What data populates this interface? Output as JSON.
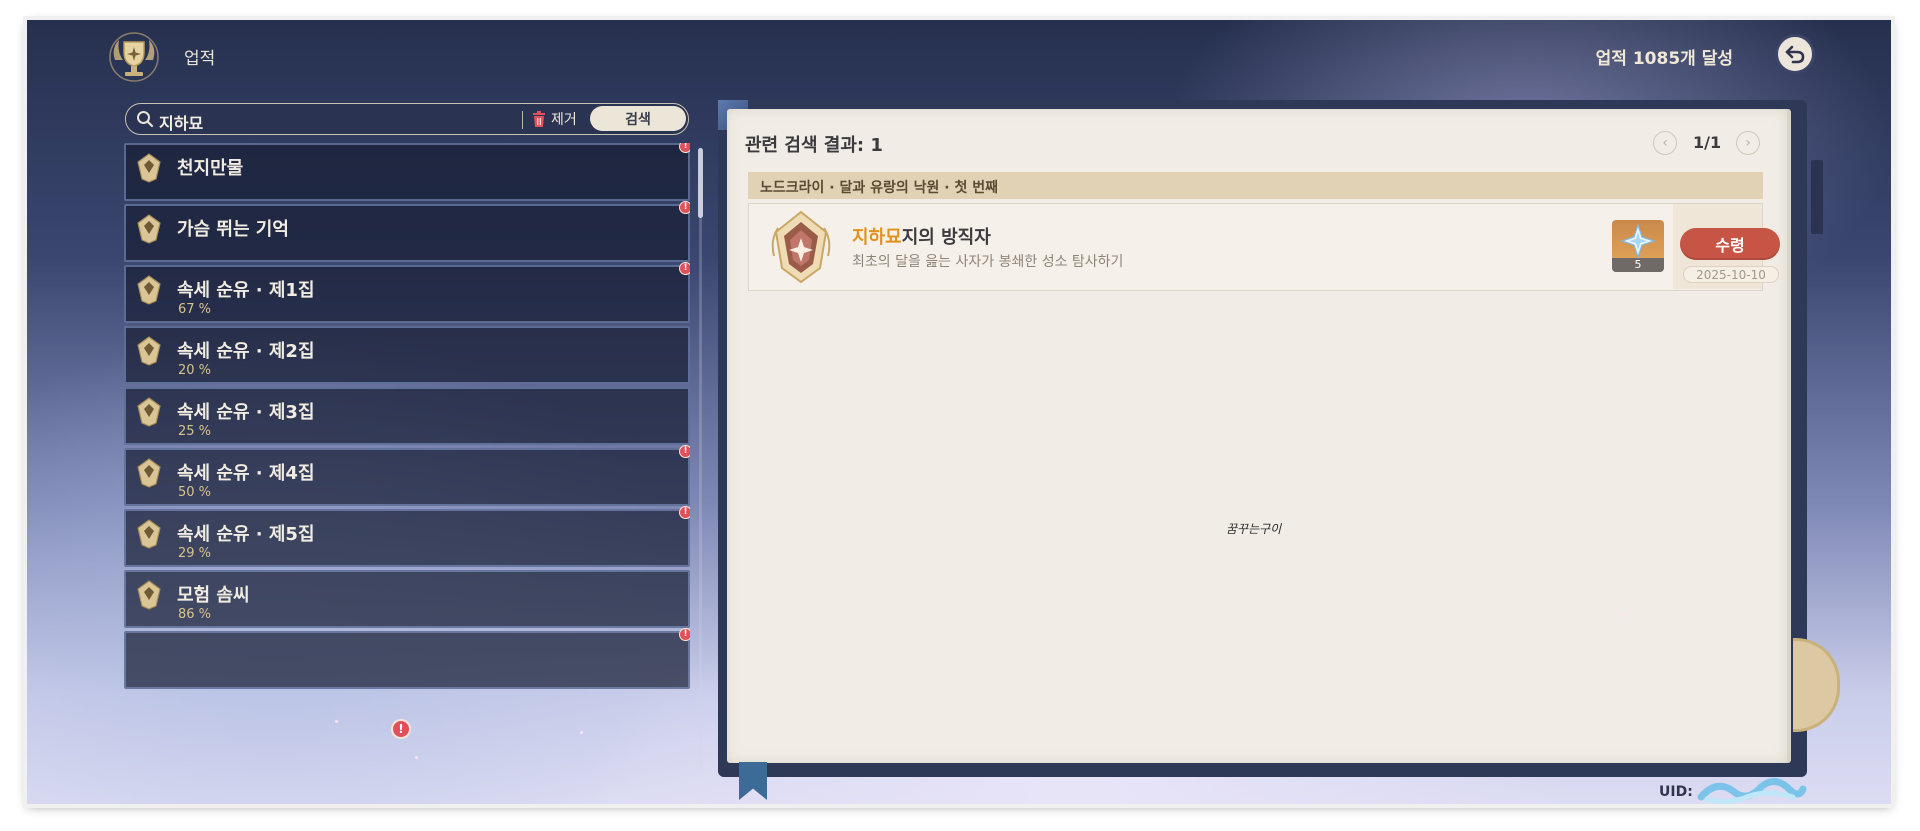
{
  "header": {
    "title": "업적",
    "achievement_count": "업적 1085개 달성"
  },
  "search": {
    "query": "지하묘",
    "clear_label": "제거",
    "search_button": "검색"
  },
  "categories": [
    {
      "name": "천지만물",
      "percent": "",
      "alert": true
    },
    {
      "name": "가슴 뛰는 기억",
      "percent": "",
      "alert": true
    },
    {
      "name": "속세 순유 · 제1집",
      "percent": "67 %",
      "alert": true
    },
    {
      "name": "속세 순유 · 제2집",
      "percent": "20 %",
      "alert": false
    },
    {
      "name": "속세 순유 · 제3집",
      "percent": "25 %",
      "alert": false
    },
    {
      "name": "속세 순유 · 제4집",
      "percent": "50 %",
      "alert": true
    },
    {
      "name": "속세 순유 · 제5집",
      "percent": "29 %",
      "alert": true
    },
    {
      "name": "모험 솜씨",
      "percent": "86 %",
      "alert": false
    }
  ],
  "results": {
    "title": "관련 검색 결과: 1",
    "page_indicator": "1/1",
    "section_title": "노드크라이 · 달과 유랑의 낙원 · 첫 번째",
    "entry": {
      "name_highlight": "지하묘",
      "name_rest": "지의 방직자",
      "description": "최초의 달을 읊는 사자가 봉쇄한 성소 탐사하기",
      "reward_count": "5",
      "claim_label": "수령",
      "date": "2025-10-10"
    }
  },
  "watermark": "꿈꾸는구이",
  "uid_label": "UID:",
  "colors": {
    "highlight": "#e2911d",
    "claim_button": "#c65546",
    "alert": "#e0505a",
    "percent": "#d8c28e"
  }
}
